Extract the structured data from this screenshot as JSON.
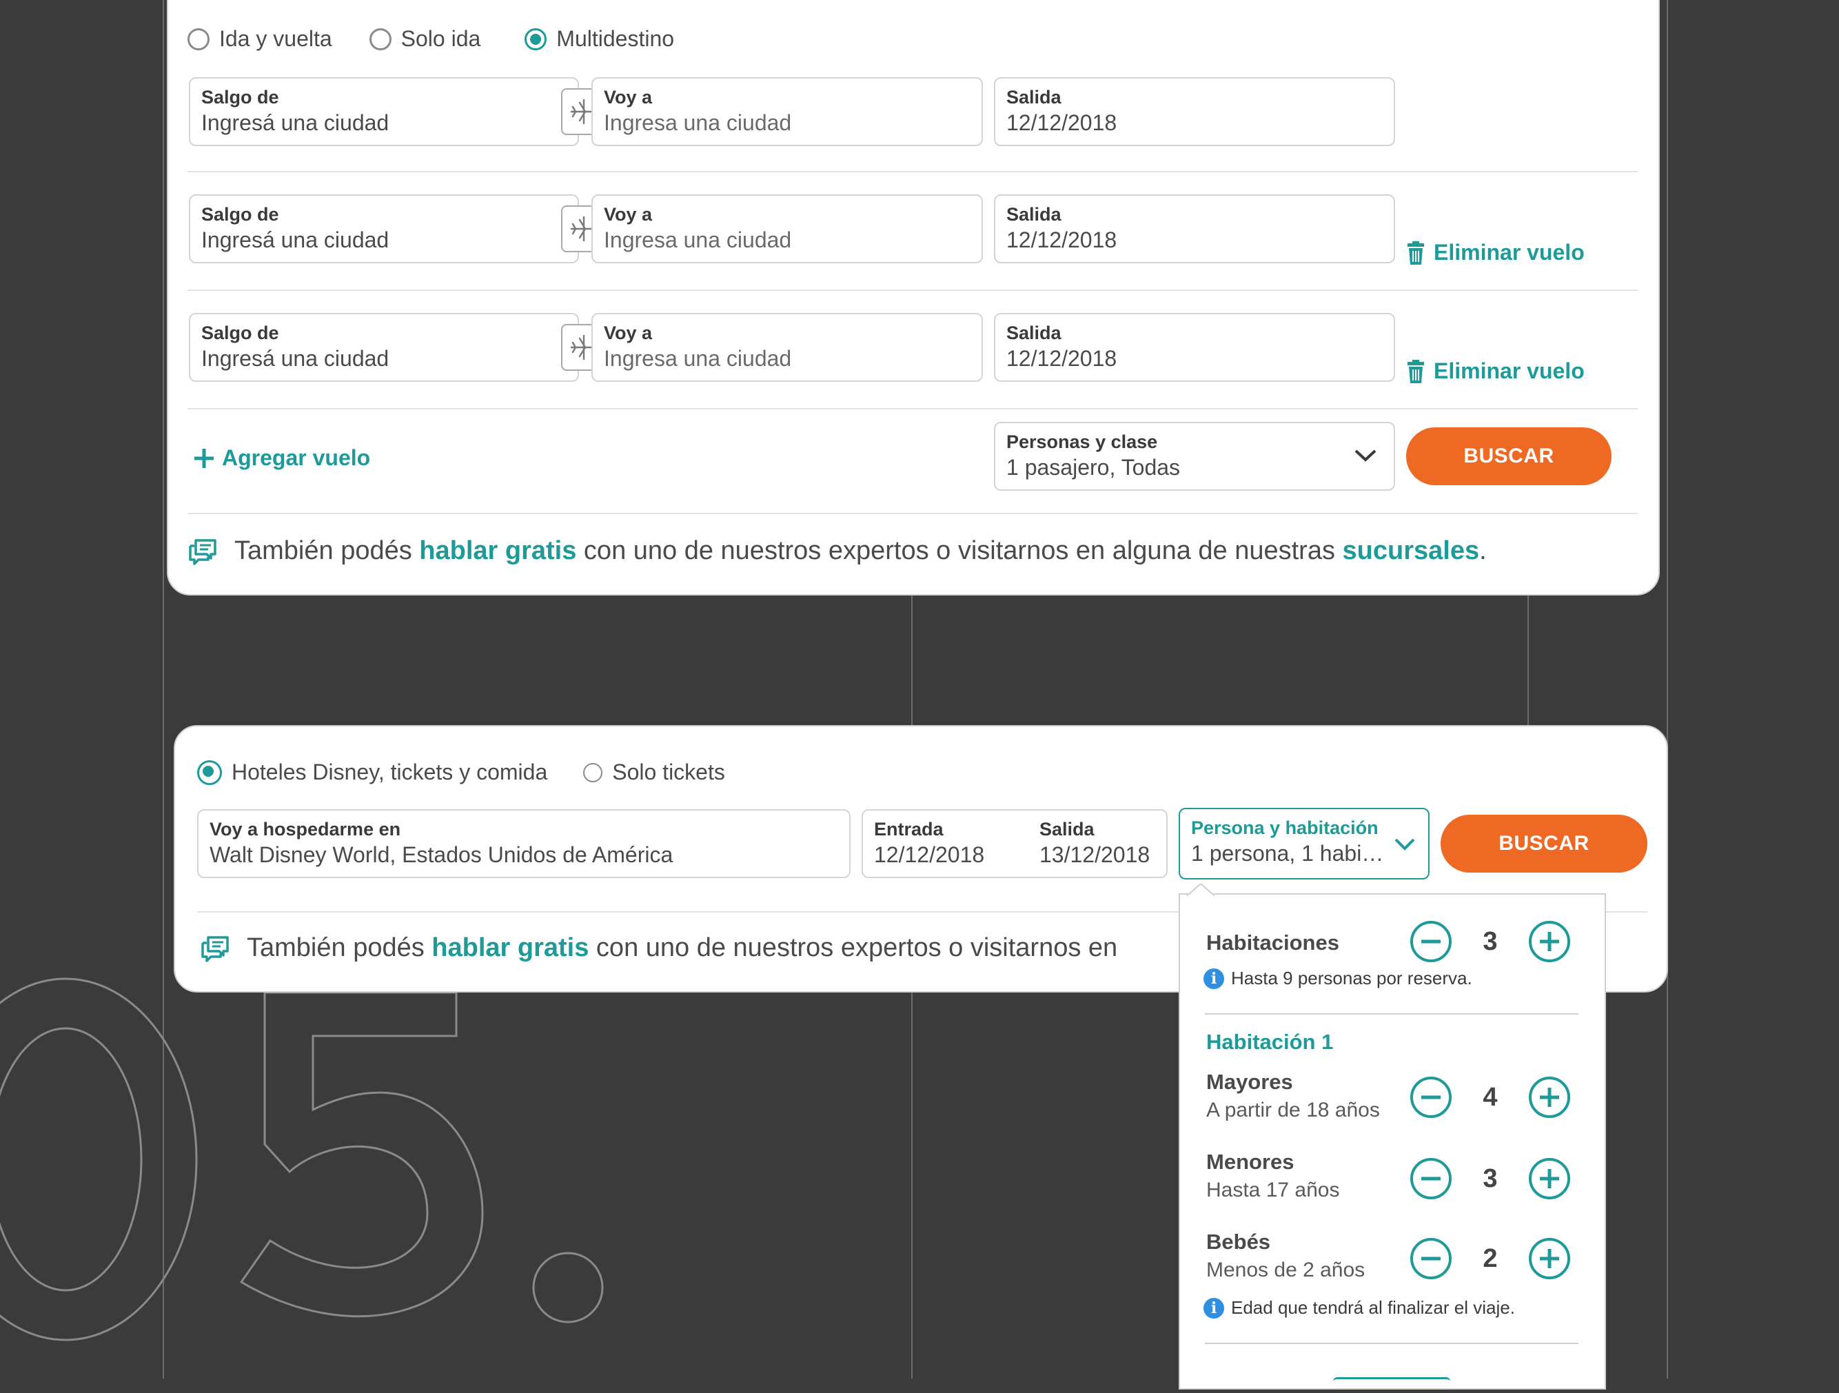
{
  "flights": {
    "trip_types": [
      {
        "label": "Ida y vuelta",
        "checked": false
      },
      {
        "label": "Solo ida",
        "checked": false
      },
      {
        "label": "Multidestino",
        "checked": true
      }
    ],
    "legs": [
      {
        "origin_label": "Salgo de",
        "origin_placeholder": "Ingresá una ciudad",
        "dest_label": "Voy a",
        "dest_placeholder": "Ingresa una ciudad",
        "date_label": "Salida",
        "date_value": "12/12/2018",
        "remove_label": ""
      },
      {
        "origin_label": "Salgo de",
        "origin_placeholder": "Ingresá una ciudad",
        "dest_label": "Voy a",
        "dest_placeholder": "Ingresa una ciudad",
        "date_label": "Salida",
        "date_value": "12/12/2018",
        "remove_label": "Eliminar vuelo"
      },
      {
        "origin_label": "Salgo de",
        "origin_placeholder": "Ingresá una ciudad",
        "dest_label": "Voy a",
        "dest_placeholder": "Ingresa una ciudad",
        "date_label": "Salida",
        "date_value": "12/12/2018",
        "remove_label": "Eliminar vuelo"
      }
    ],
    "add_flight_label": "Agregar vuelo",
    "passengers_label": "Personas y clase",
    "passengers_value": "1 pasajero, Todas",
    "search_label": "BUSCAR",
    "info": {
      "prefix": "También podés ",
      "link1": "hablar gratis",
      "middle": " con uno de nuestros expertos o visitarnos en alguna de nuestras ",
      "link2": "sucursales",
      "suffix": "."
    }
  },
  "disney": {
    "options": [
      {
        "label": "Hoteles Disney, tickets y comida",
        "checked": true
      },
      {
        "label": "Solo tickets",
        "checked": false
      }
    ],
    "destination_label": "Voy a hospedarme en",
    "destination_value": "Walt Disney World, Estados Unidos de América",
    "checkin_label": "Entrada",
    "checkin_value": "12/12/2018",
    "checkout_label": "Salida",
    "checkout_value": "13/12/2018",
    "guests_label": "Persona y habitación",
    "guests_value": "1 persona, 1 habit...",
    "search_label": "BUSCAR",
    "info": {
      "prefix": "También podés ",
      "link1": "hablar gratis",
      "middle": " con uno de nuestros expertos o visitarnos en"
    }
  },
  "guests_dropdown": {
    "rooms_label": "Habitaciones",
    "rooms_value": "3",
    "rooms_note": "Hasta 9 personas por reserva.",
    "room_title": "Habitación 1",
    "rows": [
      {
        "title": "Mayores",
        "subtitle": "A partir de 18 años",
        "value": "4"
      },
      {
        "title": "Menores",
        "subtitle": "Hasta 17 años",
        "value": "3"
      },
      {
        "title": "Bebés",
        "subtitle": "Menos de 2 años",
        "value": "2"
      }
    ],
    "age_note": "Edad que tendrá al finalizar el viaje."
  },
  "colors": {
    "accent": "#1e9a98",
    "cta": "#ee6a24",
    "background": "#3b3b3b",
    "info_icon": "#2f8fe0"
  }
}
